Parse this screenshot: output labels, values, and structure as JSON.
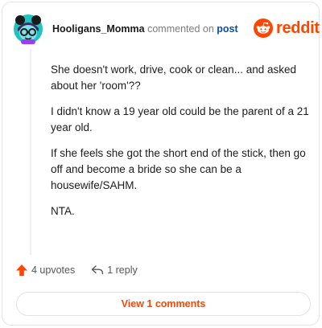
{
  "header": {
    "username": "Hooligans_Momma",
    "action_text": "commented on",
    "post_link": "post"
  },
  "brand": {
    "logo_icon": "reddit-alien-icon",
    "name": "reddit",
    "color": "#ff4500"
  },
  "comment": {
    "paragraphs": [
      "She doesn't work, drive, cook or clean... and asked about her 'room'??",
      "I didn't know a 19 year old could be the parent of a 21 year old.",
      "If she feels she got the short end of the stick, then go off and become a bride so she can be a housewife/SAHM.",
      "NTA."
    ]
  },
  "actions": {
    "upvote_icon": "upvote-arrow-icon",
    "upvotes_label": "4 upvotes",
    "reply_icon": "reply-arrow-icon",
    "replies_label": "1 reply"
  },
  "footer": {
    "view_button_label": "View 1 comments"
  },
  "colors": {
    "accent": "#ff4500",
    "link": "#0a4fa3",
    "muted": "#7c7c7c",
    "avatar_bg": "#1fc3c1"
  }
}
